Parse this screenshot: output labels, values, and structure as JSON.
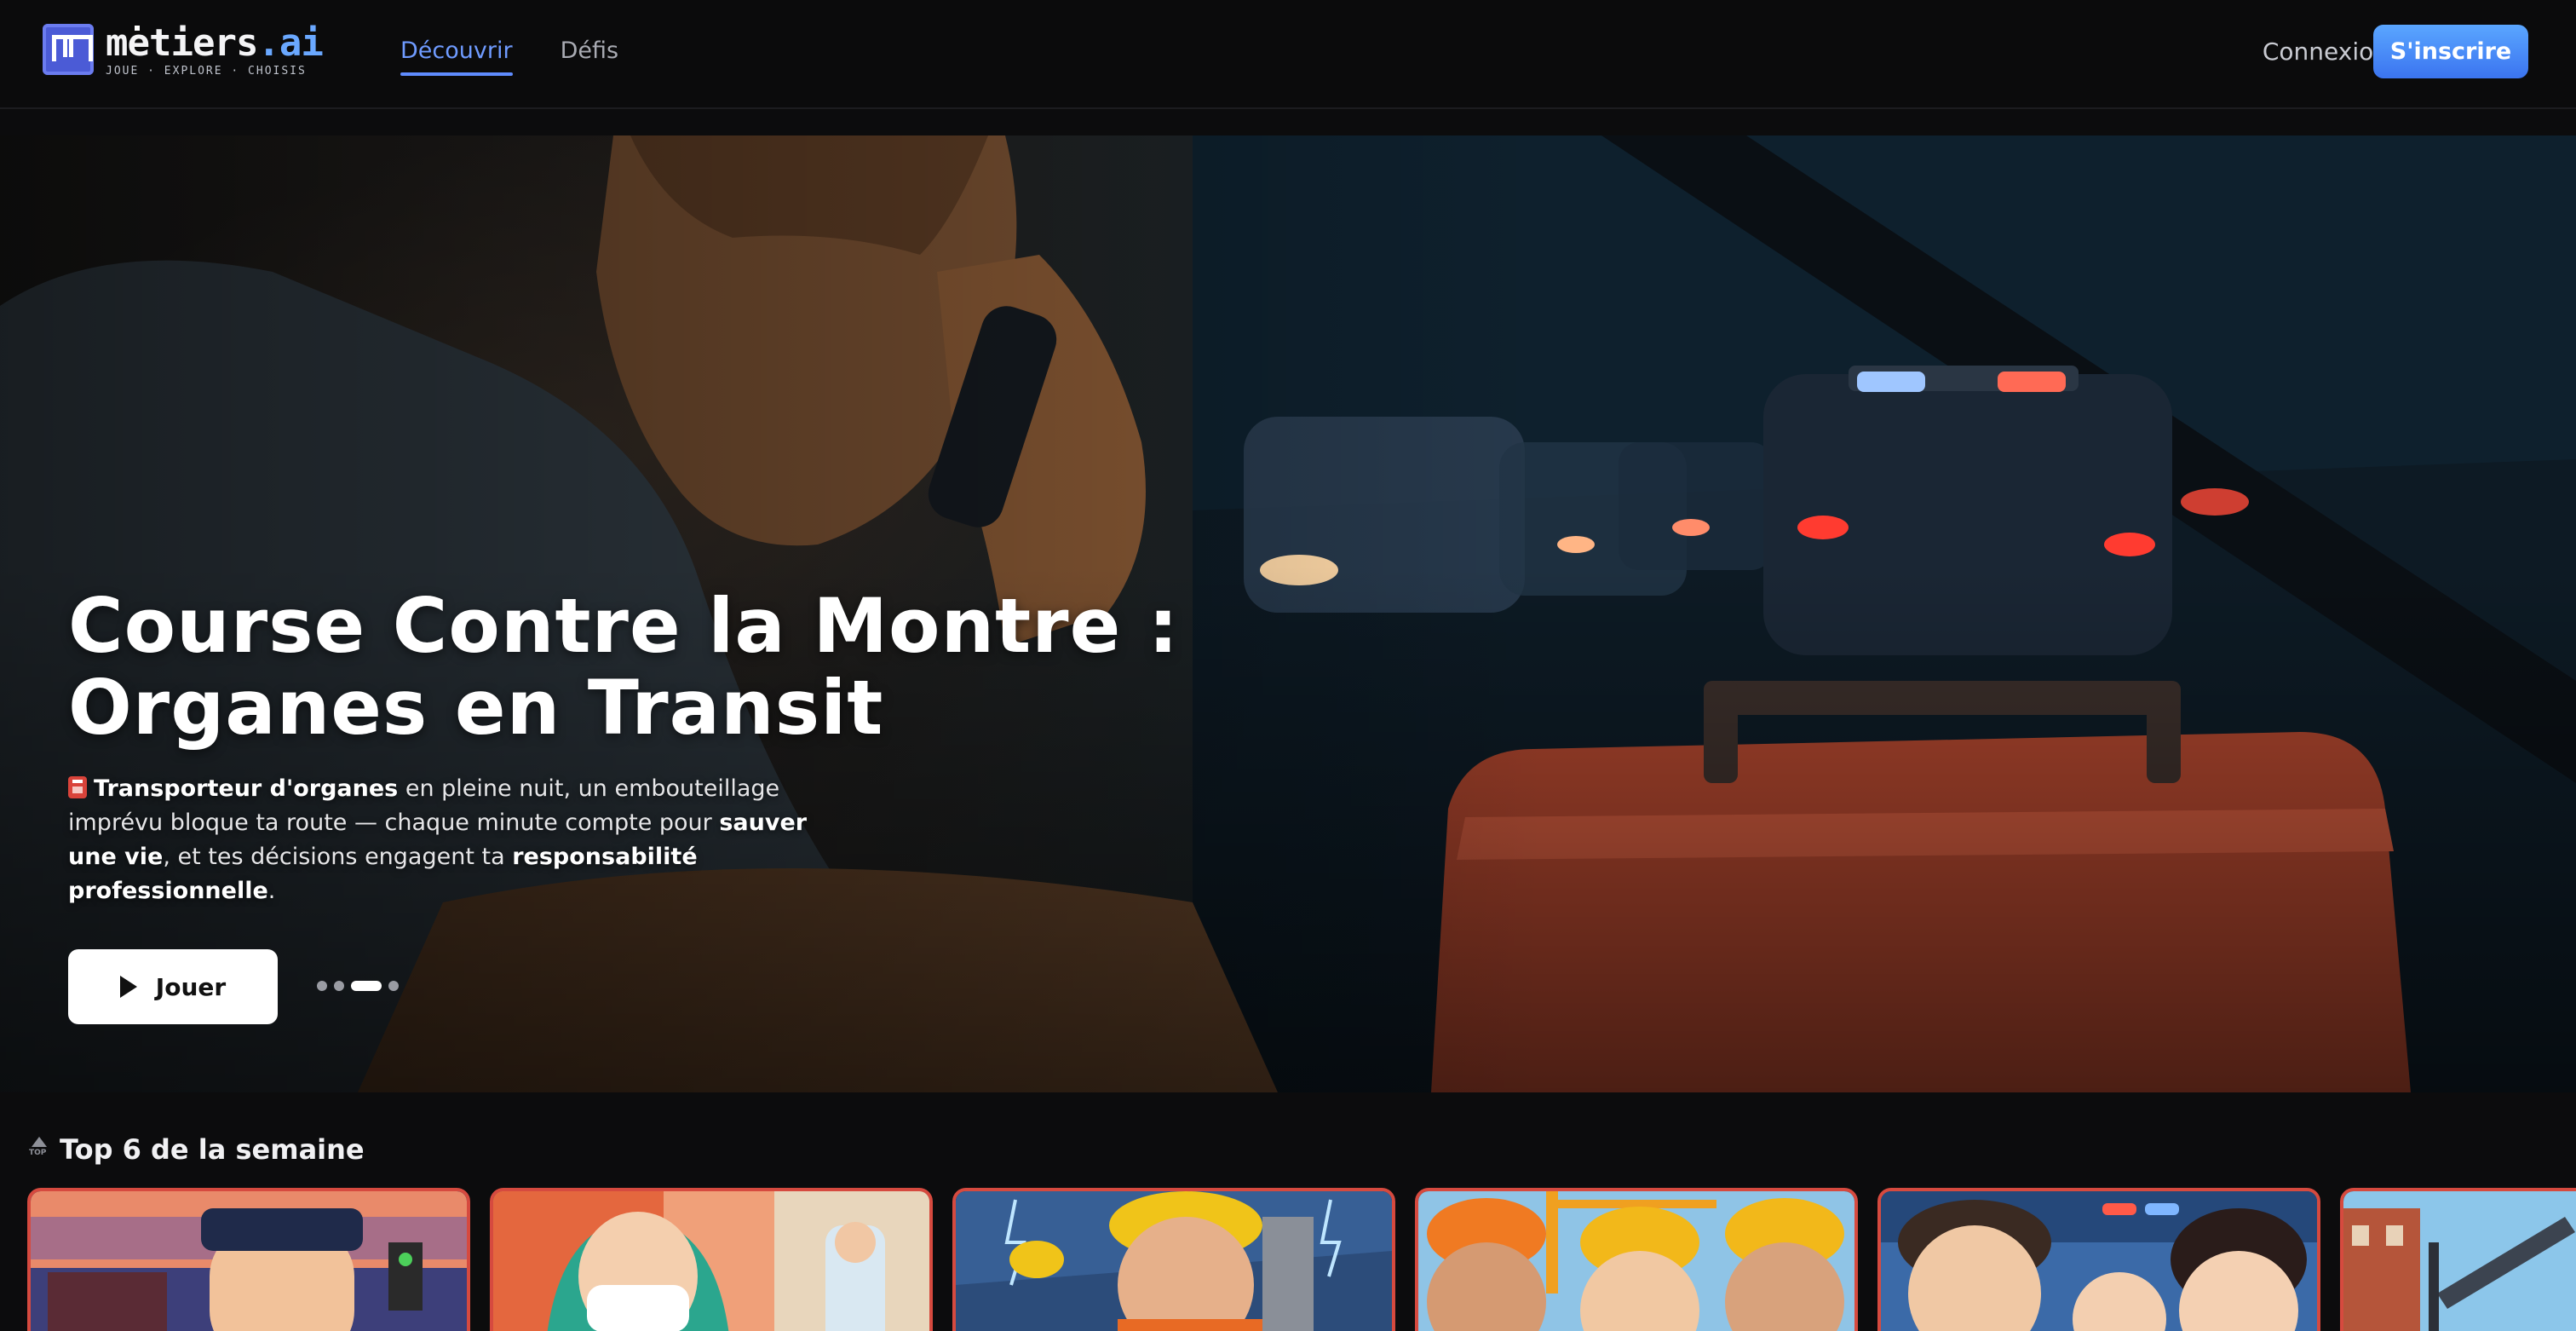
{
  "header": {
    "logo": {
      "name_main": "metiers",
      "name_suffix": ".ai",
      "tagline": "JOUE · EXPLORE · CHOISIS"
    },
    "nav": [
      {
        "label": "Découvrir",
        "active": true
      },
      {
        "label": "Défis",
        "active": false
      }
    ],
    "login_label": "Connexion",
    "signup_label": "S'inscrire"
  },
  "hero": {
    "title_line1": "Course Contre la Montre :",
    "title_line2": "Organes en Transit",
    "description": {
      "icon": "ambulance-badge-icon",
      "bold1": "Transporteur d'organes",
      "text1": " en pleine nuit, un embouteillage imprévu bloque ta route — chaque minute compte pour ",
      "bold2": "sauver une vie",
      "text2": ", et tes décisions engagent ta ",
      "bold3": "responsabilité professionnelle",
      "text3": "."
    },
    "play_label": "Jouer",
    "carousel": {
      "count": 4,
      "active_index": 2
    }
  },
  "top_section": {
    "icon": "top-arrow-icon",
    "title": "Top 6 de la semaine",
    "cards": [
      {
        "name": "train-conductor-card",
        "accent": "#d64a3f"
      },
      {
        "name": "surgeon-card",
        "accent": "#d64a3f"
      },
      {
        "name": "construction-storm-card",
        "accent": "#d64a3f"
      },
      {
        "name": "construction-workers-card",
        "accent": "#d64a3f"
      },
      {
        "name": "ambulance-crew-card",
        "accent": "#d64a3f"
      },
      {
        "name": "crane-site-card",
        "accent": "#d64a3f"
      }
    ]
  },
  "colors": {
    "accent_blue": "#5f8cff",
    "signup_gradient_top": "#5aa6ff",
    "signup_gradient_bottom": "#3b74f0",
    "card_border": "#d64a3f"
  }
}
